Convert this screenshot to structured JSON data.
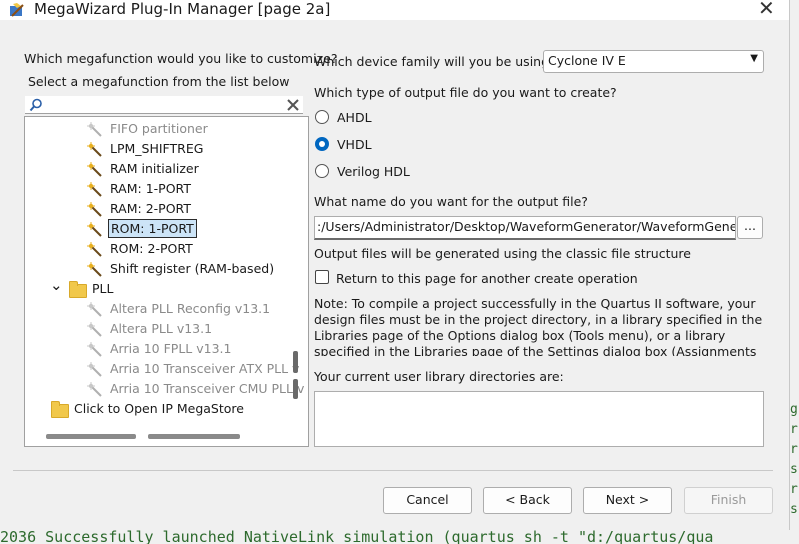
{
  "window": {
    "title": "MegaWizard Plug-In Manager [page 2a]"
  },
  "left": {
    "question": "Which megafunction would you like to customize?",
    "subtitle": "Select a megafunction from the list below",
    "search": {
      "value": ""
    },
    "tree": [
      {
        "label": "FIFO partitioner",
        "disabled": true
      },
      {
        "label": "LPM_SHIFTREG"
      },
      {
        "label": "RAM initializer"
      },
      {
        "label": "RAM: 1-PORT"
      },
      {
        "label": "RAM: 2-PORT"
      },
      {
        "label": "ROM: 1-PORT",
        "selected": true
      },
      {
        "label": "ROM: 2-PORT"
      },
      {
        "label": "Shift register (RAM-based)"
      },
      {
        "label": "PLL",
        "folder": true
      },
      {
        "label": "Altera PLL Reconfig v13.1",
        "disabled": true
      },
      {
        "label": "Altera PLL v13.1",
        "disabled": true
      },
      {
        "label": "Arria 10 FPLL v13.1",
        "disabled": true
      },
      {
        "label": "Arria 10 Transceiver ATX PLL v",
        "disabled": true
      },
      {
        "label": "Arria 10 Transceiver CMU PLL v",
        "disabled": true
      },
      {
        "label": "Click to Open IP MegaStore",
        "folder": true
      }
    ]
  },
  "right": {
    "device_question": "Which device family will you be using?",
    "device_value": "Cyclone IV E",
    "output_type_question": "Which type of output file do you want to create?",
    "output_types": [
      {
        "label": "AHDL",
        "checked": false
      },
      {
        "label": "VHDL",
        "checked": true
      },
      {
        "label": "Verilog HDL",
        "checked": false
      }
    ],
    "name_question": "What name do you want for the output file?",
    "name_value": ":/Users/Administrator/Desktop/WaveformGenerator/WaveformGenerator/",
    "browse_label": "...",
    "structure_note": "Output files will be generated using the classic file structure",
    "return_label": "Return to this page for another create operation",
    "note": "Note: To compile a project successfully in the Quartus II software, your design files must be in the project directory, in a library specified in the Libraries page of the Options dialog box (Tools menu), or a library specified in the Libraries page of the Settings dialog box (Assignments menu).",
    "library_label": "Your current user library directories are:"
  },
  "buttons": {
    "cancel": "Cancel",
    "back": "< Back",
    "next": "Next >",
    "finish": "Finish"
  },
  "console": {
    "bottom_line": "2036 Successfully launched NativeLink simulation (quartus_sh -t \"d:/quartus/qua",
    "right_chars": "g\nr\nr\ns\nr\ns"
  }
}
